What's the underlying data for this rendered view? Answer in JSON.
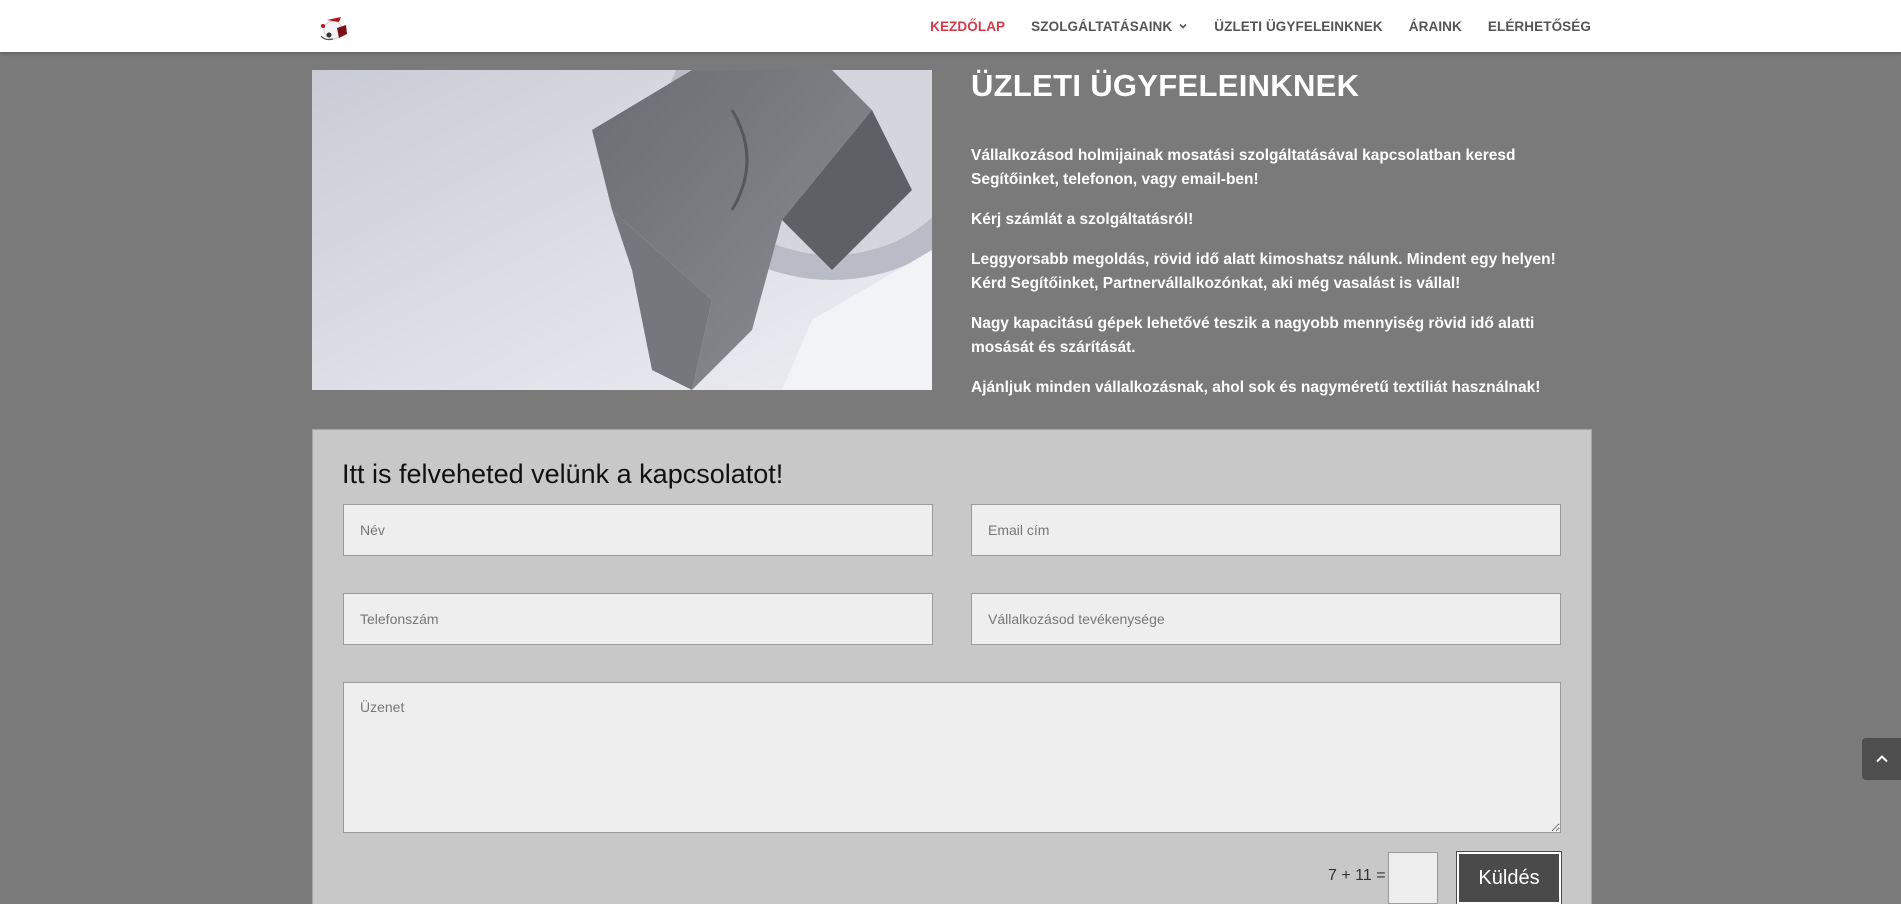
{
  "header": {
    "logo_alt": "logo",
    "nav": [
      {
        "label": "KEZDŐLAP",
        "active": true
      },
      {
        "label": "SZOLGÁLTATÁSAINK",
        "has_dropdown": true
      },
      {
        "label": "ÜZLETI ÜGYFELEINKNEK"
      },
      {
        "label": "ÁRAINK"
      },
      {
        "label": "ELÉRHETŐSÉG"
      }
    ]
  },
  "hero": {
    "image": "towel-in-washing-machine",
    "title": "ÜZLETI ÜGYFELEINKNEK",
    "paragraphs": [
      "Vállalkozásod holmijainak mosatási szolgáltatásával kapcsolatban keresd Segítőinket, telefonon, vagy email-ben!",
      "Kérj számlát a szolgáltatásról!",
      "Leggyorsabb megoldás, rövid idő alatt kimoshatsz nálunk. Mindent egy helyen! Kérd Segítőinket, Partnervállalkozónkat, aki még vasalást is vállal!",
      "Nagy kapacitású gépek lehetővé teszik a nagyobb mennyiség rövid idő alatti mosását és szárítását.",
      "Ajánljuk minden vállalkozásnak, ahol sok és nagyméretű textíliát használnak!"
    ]
  },
  "form": {
    "title": "Itt is felveheted velünk a kapcsolatot!",
    "name_placeholder": "Név",
    "email_placeholder": "Email cím",
    "phone_placeholder": "Telefonszám",
    "business_placeholder": "Vállalkozásod tevékenysége",
    "message_placeholder": "Üzenet",
    "captcha_question": "7 + 11 =",
    "submit_label": "Küldés"
  },
  "colors": {
    "background": "#7a7a7a",
    "accent_active": "#d63a4a",
    "panel": "#c8c8c8",
    "button": "#4a4a4a"
  },
  "icons": {
    "dropdown": "chevron-down-icon",
    "back_to_top": "chevron-up-icon"
  }
}
